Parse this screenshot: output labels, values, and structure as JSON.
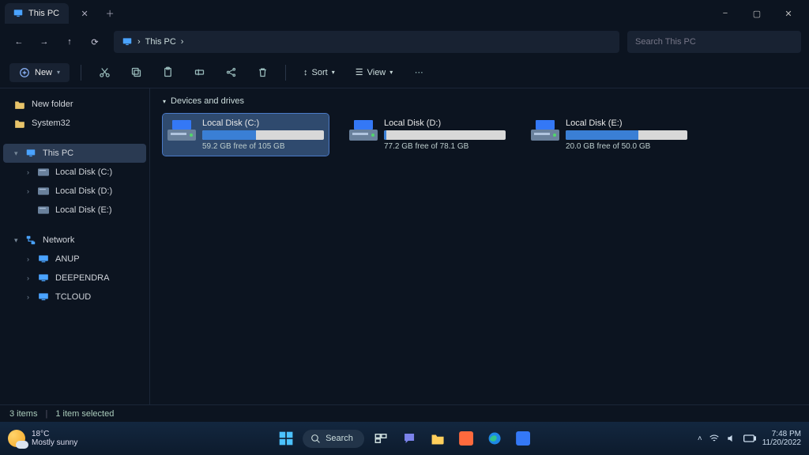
{
  "tab": {
    "title": "This PC"
  },
  "breadcrumb": {
    "icon": "monitor-icon",
    "label": "This PC",
    "sep": "›"
  },
  "search": {
    "placeholder": "Search This PC"
  },
  "toolbar": {
    "new_label": "New",
    "sort_label": "Sort",
    "view_label": "View"
  },
  "sidebar": {
    "quick": [
      {
        "label": "New folder",
        "icon": "folder"
      },
      {
        "label": "System32",
        "icon": "folder"
      }
    ],
    "thispc_label": "This PC",
    "drives": [
      {
        "label": "Local Disk (C:)"
      },
      {
        "label": "Local Disk (D:)"
      },
      {
        "label": "Local Disk (E:)"
      }
    ],
    "network_label": "Network",
    "network": [
      {
        "label": "ANUP"
      },
      {
        "label": "DEEPENDRA"
      },
      {
        "label": "TCLOUD"
      }
    ]
  },
  "main": {
    "group_label": "Devices and drives",
    "drives": [
      {
        "name": "Local Disk (C:)",
        "sub": "59.2 GB free of 105 GB",
        "fill_pct": 44,
        "selected": true
      },
      {
        "name": "Local Disk (D:)",
        "sub": "77.2 GB free of 78.1 GB",
        "fill_pct": 2,
        "selected": false
      },
      {
        "name": "Local Disk (E:)",
        "sub": "20.0 GB free of 50.0 GB",
        "fill_pct": 60,
        "selected": false
      }
    ]
  },
  "status": {
    "items": "3 items",
    "selected": "1 item selected"
  },
  "taskbar": {
    "weather_temp": "18°C",
    "weather_desc": "Mostly sunny",
    "search_label": "Search",
    "time": "7:48 PM",
    "date": "11/20/2022"
  }
}
